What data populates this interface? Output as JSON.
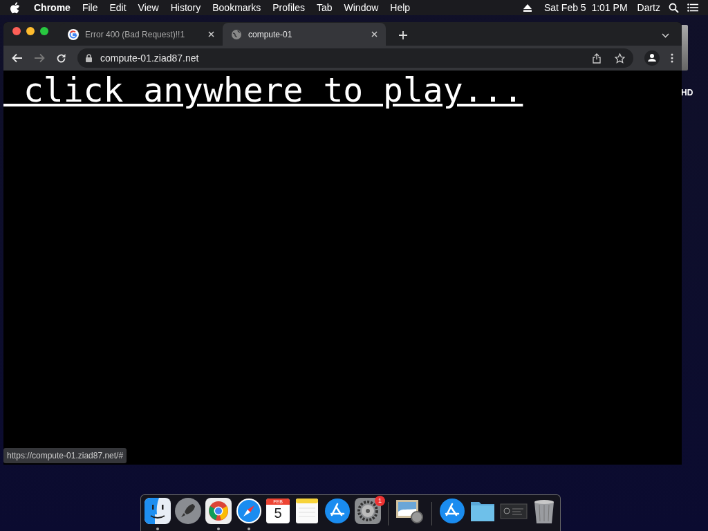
{
  "menu_bar": {
    "app": "Chrome",
    "menus": [
      "File",
      "Edit",
      "View",
      "History",
      "Bookmarks",
      "Profiles",
      "Tab",
      "Window",
      "Help"
    ],
    "clock": "Sat Feb 5  1:01 PM",
    "user": "Dartz"
  },
  "desktop_icon": {
    "label": "HD"
  },
  "browser": {
    "tabs": [
      {
        "title": "Error 400 (Bad Request)!!1",
        "kind": "google",
        "selected": false
      },
      {
        "title": "compute-01",
        "kind": "globe",
        "selected": true
      }
    ],
    "address": "compute-01.ziad87.net",
    "page_text": " click anywhere to play...",
    "status_url": "https://compute-01.ziad87.net/#"
  },
  "dock": {
    "items": [
      {
        "kind": "finder",
        "running": true
      },
      {
        "kind": "launchpad",
        "running": false
      },
      {
        "kind": "chrome",
        "running": true
      },
      {
        "kind": "safari",
        "running": true
      },
      {
        "kind": "calendar",
        "running": false,
        "month": "FEB",
        "day": "5"
      },
      {
        "kind": "notes",
        "running": false
      },
      {
        "kind": "appstore",
        "running": false
      },
      {
        "kind": "settings",
        "running": false,
        "badge": "1"
      },
      {
        "kind": "separator"
      },
      {
        "kind": "preview",
        "running": false
      },
      {
        "kind": "separator"
      },
      {
        "kind": "appstore",
        "running": false
      },
      {
        "kind": "folder",
        "running": false
      },
      {
        "kind": "screenshot",
        "running": false
      },
      {
        "kind": "trash",
        "running": false
      }
    ]
  }
}
